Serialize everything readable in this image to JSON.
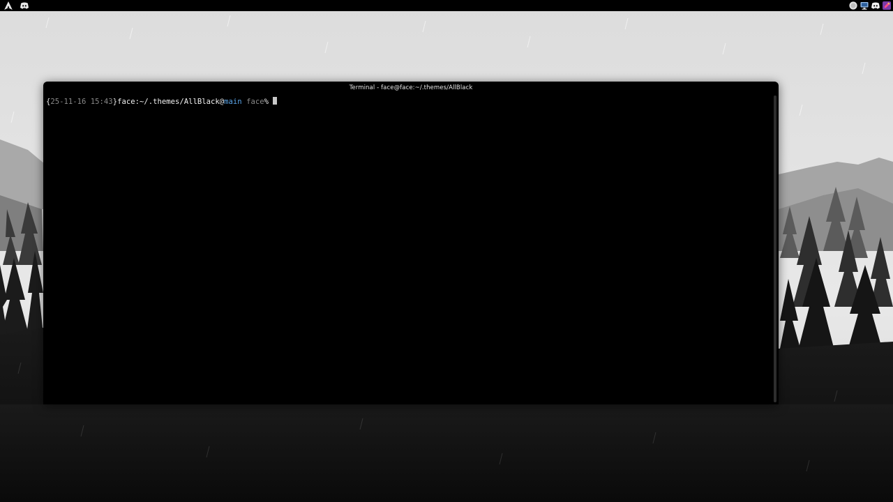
{
  "panel": {
    "left_icons": [
      "arch-logo-icon",
      "discord-icon"
    ],
    "right_icons": [
      "circle-status-icon",
      "network-icon",
      "discord-tray-icon",
      "color-picker-icon"
    ]
  },
  "terminal": {
    "title": "Terminal - face@face:~/.themes/AllBlack",
    "prompt": {
      "open_brace": "{",
      "date": "25-11-16 15:43",
      "close_brace": "}",
      "host_path": "face:~/.themes/AllBlack",
      "at": "@",
      "branch": "main",
      "user": "face",
      "symbol": "%"
    }
  },
  "colors": {
    "panel_bg": "#000000",
    "terminal_bg": "#000000",
    "branch": "#5aa4e8",
    "dim_text": "#8a8a8a",
    "bright_text": "#f2f2f2"
  }
}
